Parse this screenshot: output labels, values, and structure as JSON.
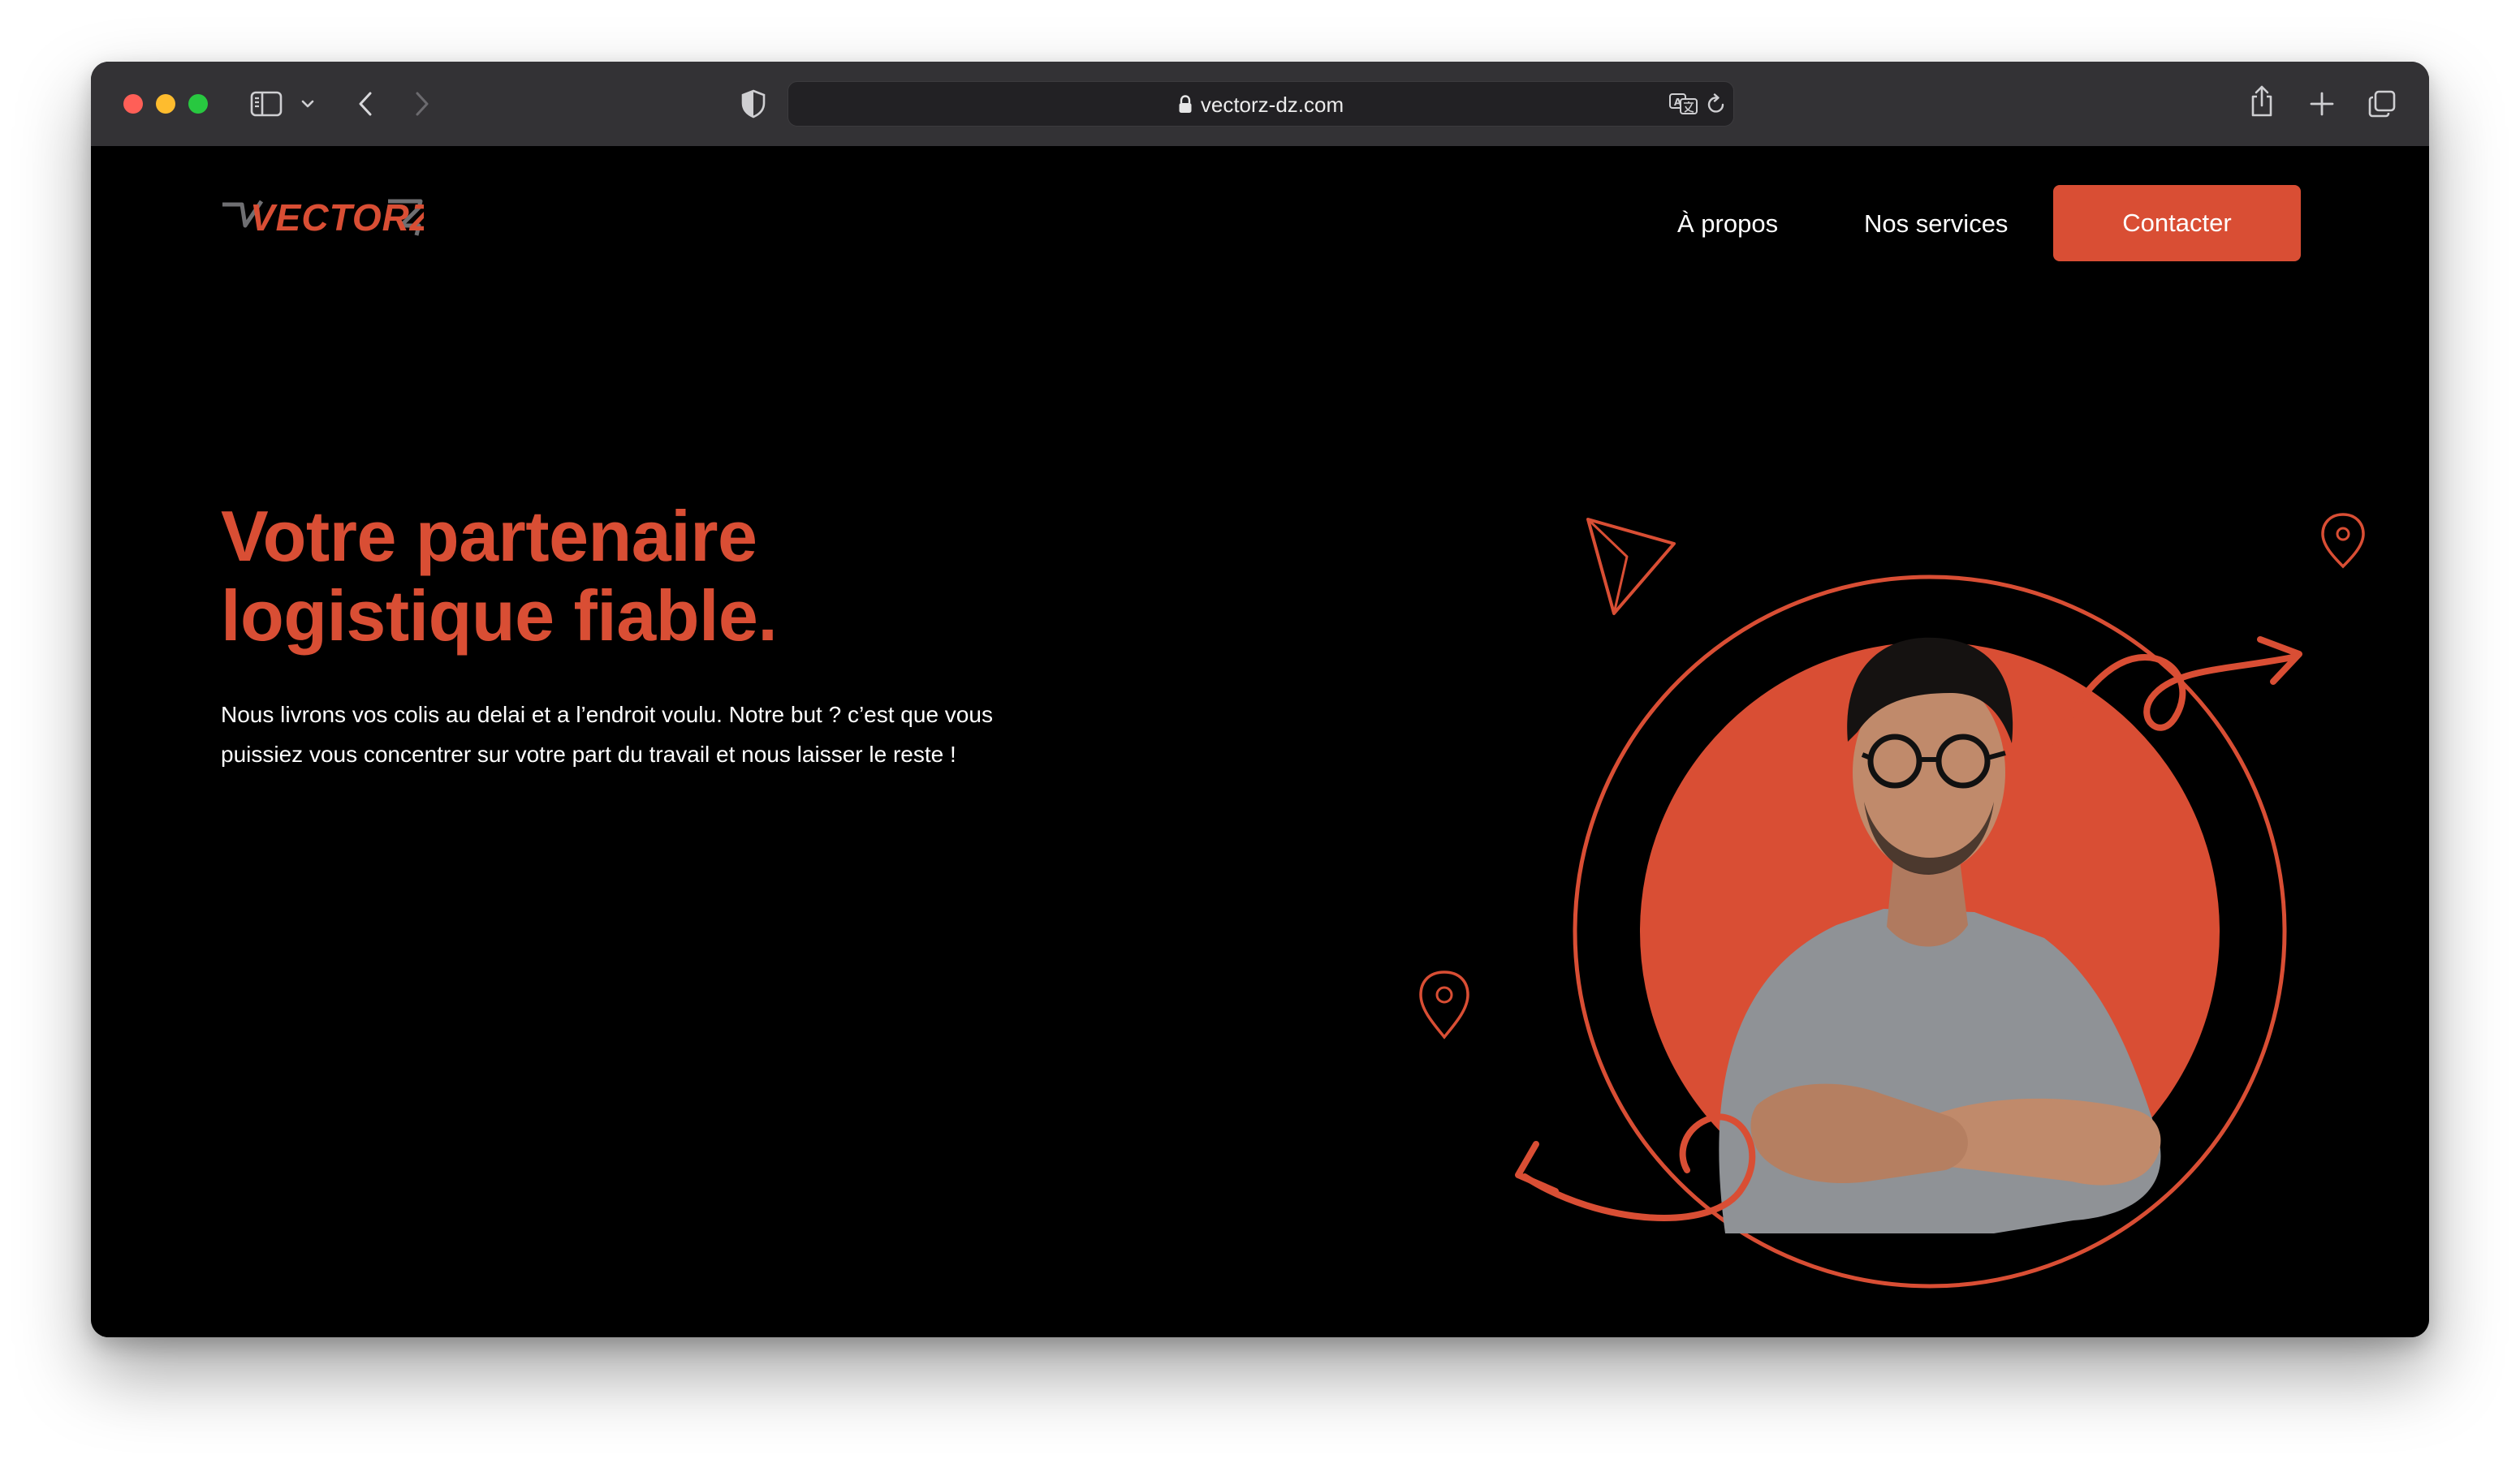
{
  "browser": {
    "url": "vectorz-dz.com",
    "traffic_lights": {
      "close": "#ff5f57",
      "minimize": "#febc2e",
      "zoom": "#28c840"
    },
    "icons": [
      "sidebar-icon",
      "chevron-down-icon",
      "back-icon",
      "forward-icon",
      "privacy-shield-icon",
      "lock-icon",
      "translate-icon",
      "reload-icon",
      "share-icon",
      "new-tab-icon",
      "tab-overview-icon"
    ]
  },
  "site": {
    "logo_text": "VECTORZ",
    "nav": {
      "links": [
        {
          "label": "À propos"
        },
        {
          "label": "Nos services"
        }
      ],
      "cta": "Contacter"
    },
    "hero": {
      "title_line1": "Votre partenaire",
      "title_line2": "logistique fiable.",
      "description": "Nous livrons vos colis au delai et a l’endroit voulu. Notre but ? c’est que vous puissiez vous concentrer sur votre part du travail et nous laisser le reste !"
    },
    "colors": {
      "accent": "#d94e34",
      "background": "#000000",
      "text": "#ffffff"
    }
  }
}
